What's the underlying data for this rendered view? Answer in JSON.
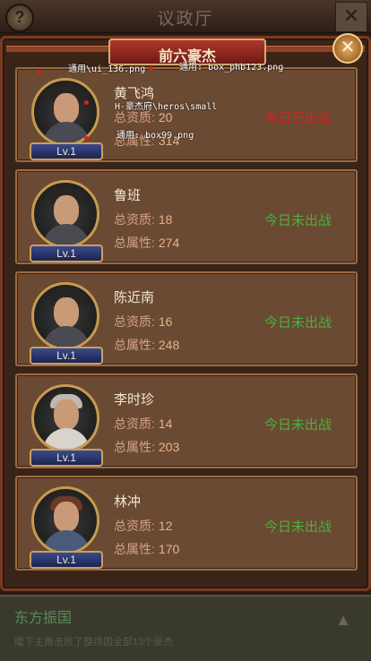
{
  "top": {
    "title": "议政厅",
    "help": "?",
    "close": "✕"
  },
  "panel": {
    "title": "前六豪杰",
    "close": "✕"
  },
  "labels": {
    "aptitude": "总资质:",
    "attribute": "总属性:"
  },
  "heroes": [
    {
      "name": "黄飞鸿",
      "level": "Lv.1",
      "aptitude": "20",
      "attribute": "314",
      "status": "今日已出战",
      "fought": true
    },
    {
      "name": "鲁班",
      "level": "Lv.1",
      "aptitude": "18",
      "attribute": "274",
      "status": "今日未出战",
      "fought": false
    },
    {
      "name": "陈近南",
      "level": "Lv.1",
      "aptitude": "16",
      "attribute": "248",
      "status": "今日未出战",
      "fought": false
    },
    {
      "name": "李时珍",
      "level": "Lv.1",
      "aptitude": "14",
      "attribute": "203",
      "status": "今日未出战",
      "fought": false
    },
    {
      "name": "林冲",
      "level": "Lv.1",
      "aptitude": "12",
      "attribute": "170",
      "status": "今日未出战",
      "fought": false
    }
  ],
  "annotations": {
    "a1": "通用\\ui_136.png",
    "a2": "通用: box_phb123.png",
    "a3": "H-豪杰府\\heros\\small",
    "a4": "通用: box99.png"
  },
  "footer": {
    "title": "东方振国",
    "text": "麾下主角击败了整纬国全部13个豪杰"
  },
  "colors": {
    "status_fought": "#d82020",
    "status_not_fought": "#4caf40"
  }
}
